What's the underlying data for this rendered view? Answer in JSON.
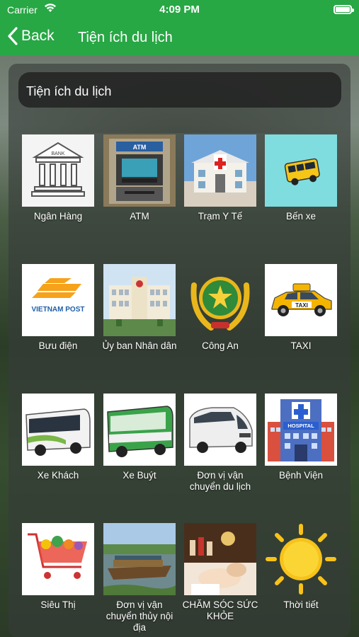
{
  "status_bar": {
    "carrier": "Carrier",
    "time": "4:09 PM"
  },
  "nav": {
    "back_label": "Back",
    "title": "Tiện ích du lịch"
  },
  "panel": {
    "title": "Tiện ích du lịch"
  },
  "colors": {
    "header": "#28a745",
    "panel": "#373c3a"
  },
  "items": [
    {
      "label": "Ngân Hàng",
      "icon": "bank-icon"
    },
    {
      "label": "ATM",
      "icon": "atm-icon"
    },
    {
      "label": "Trạm Y Tế",
      "icon": "clinic-icon"
    },
    {
      "label": "Bến xe",
      "icon": "bus-station-icon"
    },
    {
      "label": "Bưu điện",
      "icon": "post-office-icon"
    },
    {
      "label": "Ủy ban Nhân dân",
      "icon": "peoples-committee-icon"
    },
    {
      "label": "Công An",
      "icon": "police-icon"
    },
    {
      "label": "TAXI",
      "icon": "taxi-icon"
    },
    {
      "label": "Xe Khách",
      "icon": "coach-icon"
    },
    {
      "label": "Xe Buýt",
      "icon": "bus-icon"
    },
    {
      "label": "Đơn vị vận chuyển du lịch",
      "icon": "tour-van-icon"
    },
    {
      "label": "Bệnh Viện",
      "icon": "hospital-icon"
    },
    {
      "label": "Siêu Thị",
      "icon": "supermarket-icon"
    },
    {
      "label": "Đơn vị vận chuyển thủy nội địa",
      "icon": "boat-icon"
    },
    {
      "label": "CHĂM SÓC SỨC KHỎE",
      "icon": "spa-icon"
    },
    {
      "label": "Thời tiết",
      "icon": "weather-sun-icon"
    }
  ],
  "image_text": {
    "bank": "BANK",
    "atm": "ATM",
    "post": "VIETNAM POST",
    "taxi": "TAXI",
    "hospital": "HOSPITAL"
  }
}
